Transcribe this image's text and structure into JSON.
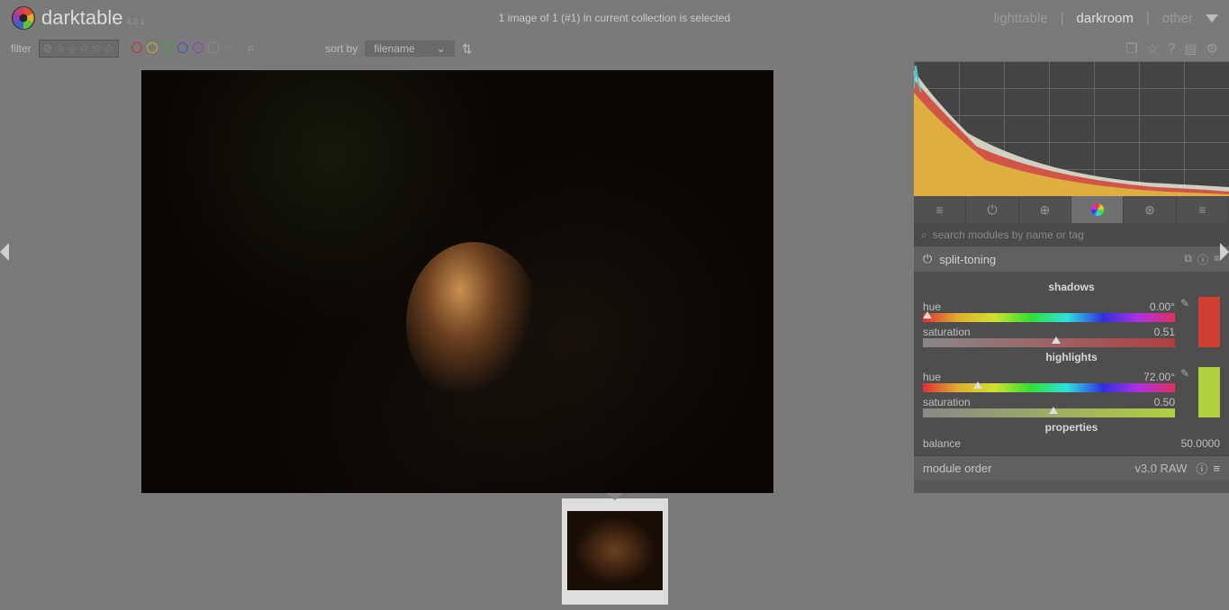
{
  "app": {
    "name": "darktable",
    "version": "4.0.1"
  },
  "status": "1 image of 1 (#1) in current collection is selected",
  "nav": {
    "lighttable": "lighttable",
    "darkroom": "darkroom",
    "other": "other"
  },
  "toolbar": {
    "filter_label": "filter",
    "sort_label": "sort by",
    "sort_value": "filename"
  },
  "color_labels": [
    "#c03838",
    "#c0b030",
    "#3aa03a",
    "#3858c0",
    "#9040c0",
    "#888",
    "#888"
  ],
  "module_search_placeholder": "search modules by name or tag",
  "split_toning": {
    "title": "split-toning",
    "shadows_label": "shadows",
    "shadows": {
      "hue_label": "hue",
      "hue_value": "0.00°",
      "sat_label": "saturation",
      "sat_value": "0.51"
    },
    "highlights_label": "highlights",
    "highlights": {
      "hue_label": "hue",
      "hue_value": "72.00°",
      "sat_label": "saturation",
      "sat_value": "0.50"
    },
    "properties_label": "properties",
    "balance_label": "balance",
    "balance_value": "50.0000"
  },
  "module_order": {
    "label": "module order",
    "value": "v3.0 RAW"
  }
}
